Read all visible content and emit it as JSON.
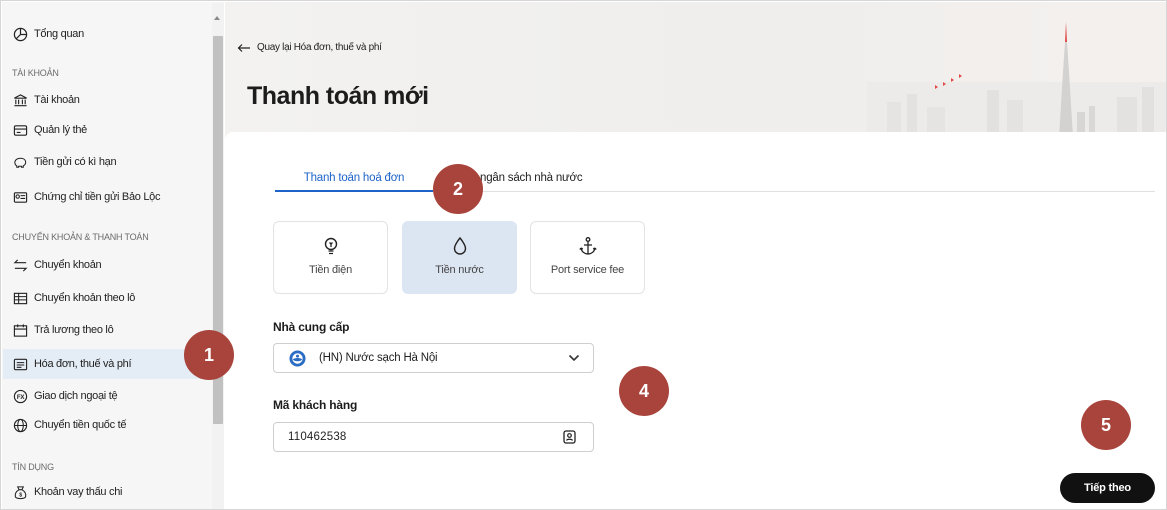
{
  "sidebar": {
    "overview": "Tổng quan",
    "section_account": "TÀI KHOẢN",
    "account": "Tài khoản",
    "card_mgmt": "Quản lý thẻ",
    "term_deposit": "Tiền gửi có kì hạn",
    "certificate": "Chứng chỉ tiền gửi Bảo Lộc",
    "section_transfer": "CHUYỂN KHOẢN & THANH TOÁN",
    "transfer": "Chuyển khoản",
    "batch_transfer": "Chuyển khoản theo lô",
    "batch_payroll": "Trả lương theo lô",
    "bills": "Hóa đơn, thuế và phí",
    "fx": "Giao dịch ngoại tệ",
    "intl_transfer": "Chuyển tiền quốc tế",
    "section_credit": "TÍN DỤNG",
    "overdraft": "Khoản vay thấu chi"
  },
  "header": {
    "back_label": "Quay lại Hóa đơn, thuế và phí",
    "title": "Thanh toán mới"
  },
  "tabs": {
    "active": "Thanh toán hoá đơn",
    "second": "ngân sách nhà nước"
  },
  "services": [
    {
      "label": "Tiền điện",
      "icon": "lightbulb-icon"
    },
    {
      "label": "Tiền nước",
      "icon": "water-drop-icon"
    },
    {
      "label": "Port service fee",
      "icon": "anchor-icon"
    }
  ],
  "form": {
    "provider_label": "Nhà cung cấp",
    "provider_value": "(HN) Nước sạch Hà Nội",
    "customer_label": "Mã khách hàng",
    "customer_value": "110462538"
  },
  "next_label": "Tiếp theo",
  "badges": [
    "1",
    "2",
    "4",
    "5"
  ],
  "colors": {
    "accent": "#1d63c9",
    "badge": "#a8443c",
    "selected_bg": "#dce5f2",
    "active_nav_bg": "#e4ecf5",
    "button_bg": "#111111"
  }
}
